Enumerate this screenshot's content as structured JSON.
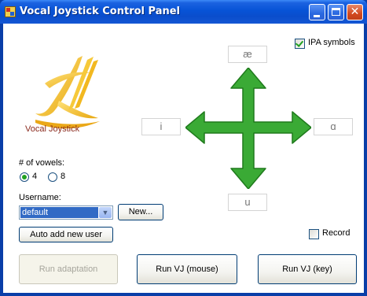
{
  "window": {
    "title": "Vocal Joystick Control Panel"
  },
  "logo": {
    "text": "Vocal Joystick"
  },
  "options": {
    "ipa_label": "IPA symbols",
    "ipa_checked": true,
    "record_label": "Record",
    "record_checked": false
  },
  "vowels": {
    "top": "æ",
    "left": "i",
    "right": "ɑ",
    "bottom": "u"
  },
  "num_vowels": {
    "label": "# of vowels:",
    "options": [
      "4",
      "8"
    ],
    "selected": "4"
  },
  "user": {
    "label": "Username:",
    "selected": "default",
    "new_button": "New...",
    "auto_add_button": "Auto add new user"
  },
  "actions": {
    "adaptation": "Run adaptation",
    "mouse": "Run VJ (mouse)",
    "key": "Run VJ (key)"
  },
  "colors": {
    "arrow": "#3aaa35",
    "arrow_border": "#1f7a1c",
    "title_bar": "#0a4dcc"
  }
}
